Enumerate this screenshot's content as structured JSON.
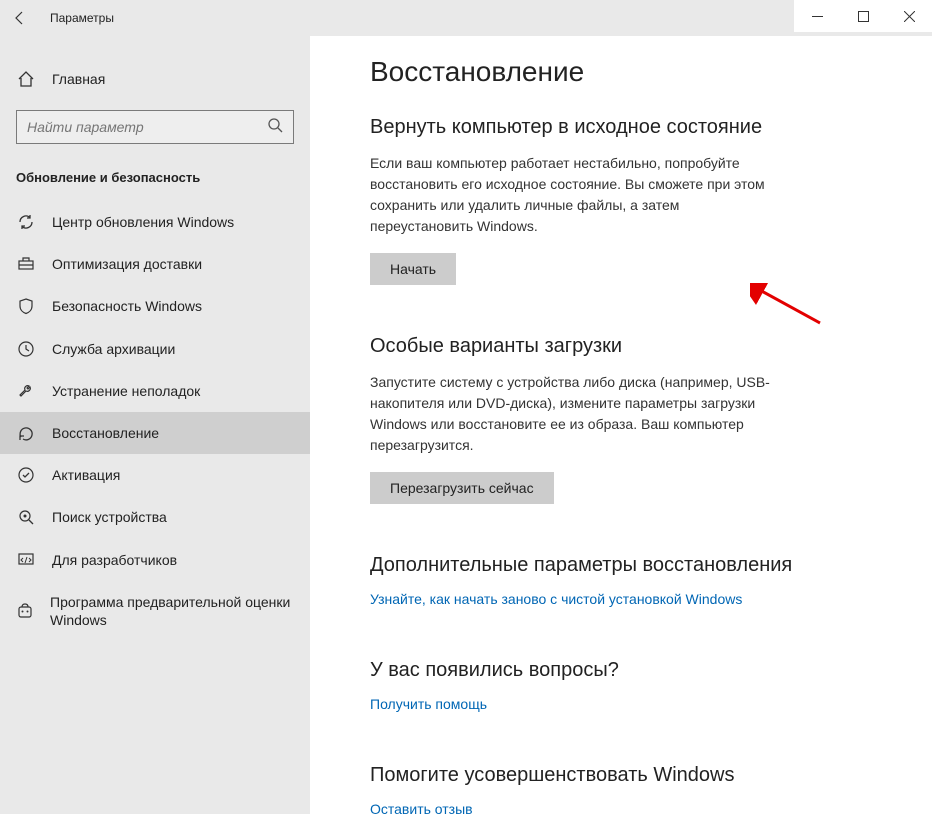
{
  "titlebar": {
    "title": "Параметры"
  },
  "sidebar": {
    "home_label": "Главная",
    "search_placeholder": "Найти параметр",
    "section_header": "Обновление и безопасность",
    "items": [
      {
        "label": "Центр обновления Windows",
        "icon": "sync"
      },
      {
        "label": "Оптимизация доставки",
        "icon": "delivery"
      },
      {
        "label": "Безопасность Windows",
        "icon": "shield"
      },
      {
        "label": "Служба архивации",
        "icon": "backup"
      },
      {
        "label": "Устранение неполадок",
        "icon": "troubleshoot"
      },
      {
        "label": "Восстановление",
        "icon": "recovery",
        "selected": true
      },
      {
        "label": "Активация",
        "icon": "activation"
      },
      {
        "label": "Поиск устройства",
        "icon": "findmydevice"
      },
      {
        "label": "Для разработчиков",
        "icon": "developers"
      },
      {
        "label": "Программа предварительной оценки Windows",
        "icon": "insider"
      }
    ]
  },
  "content": {
    "page_title": "Восстановление",
    "sections": [
      {
        "title": "Вернуть компьютер в исходное состояние",
        "text": "Если ваш компьютер работает нестабильно, попробуйте восстановить его исходное состояние. Вы сможете при этом сохранить или удалить личные файлы, а затем переустановить Windows.",
        "button": "Начать"
      },
      {
        "title": "Особые варианты загрузки",
        "text": "Запустите систему с устройства либо диска (например, USB-накопителя или DVD-диска), измените параметры загрузки Windows или восстановите ее из образа. Ваш компьютер перезагрузится.",
        "button": "Перезагрузить сейчас"
      },
      {
        "title": "Дополнительные параметры восстановления",
        "link": "Узнайте, как начать заново с чистой установкой Windows"
      },
      {
        "title": "У вас появились вопросы?",
        "link": "Получить помощь"
      },
      {
        "title": "Помогите усовершенствовать Windows",
        "link": "Оставить отзыв"
      }
    ]
  }
}
